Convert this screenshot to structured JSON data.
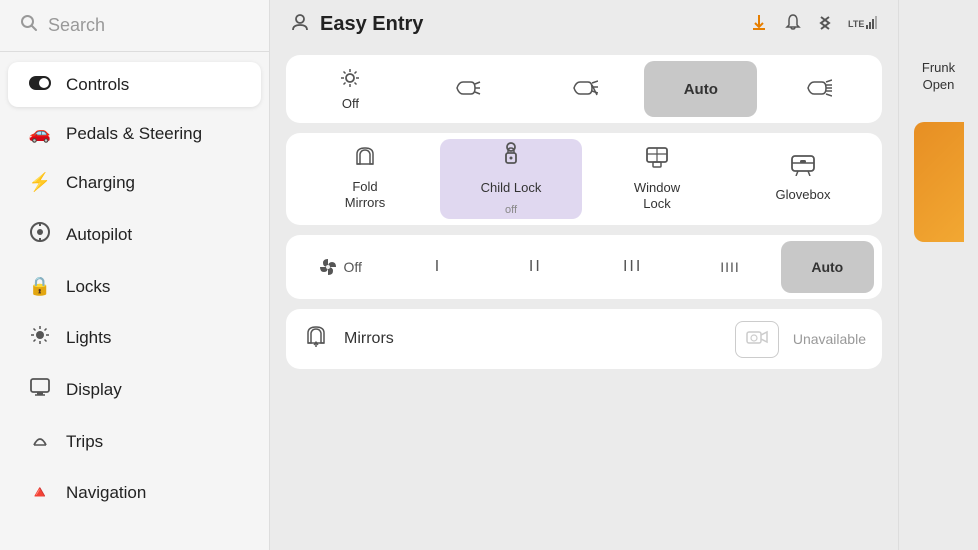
{
  "sidebar": {
    "search_placeholder": "Search",
    "items": [
      {
        "id": "controls",
        "label": "Controls",
        "icon": "toggle",
        "active": true
      },
      {
        "id": "pedals",
        "label": "Pedals & Steering",
        "icon": "car",
        "active": false
      },
      {
        "id": "charging",
        "label": "Charging",
        "icon": "bolt",
        "active": false
      },
      {
        "id": "autopilot",
        "label": "Autopilot",
        "icon": "steering",
        "active": false
      },
      {
        "id": "locks",
        "label": "Locks",
        "icon": "lock",
        "active": false
      },
      {
        "id": "lights",
        "label": "Lights",
        "icon": "sun",
        "active": false
      },
      {
        "id": "display",
        "label": "Display",
        "icon": "display",
        "active": false
      },
      {
        "id": "trips",
        "label": "Trips",
        "icon": "trips",
        "active": false
      },
      {
        "id": "navigation",
        "label": "Navigation",
        "icon": "nav",
        "active": false
      }
    ]
  },
  "header": {
    "title": "Easy Entry",
    "icons": {
      "download": "⬇",
      "bell": "🔔",
      "bluetooth": "🔵",
      "lte": "LTE"
    }
  },
  "light_controls": {
    "buttons": [
      {
        "id": "off",
        "label": "Off",
        "icon": "sun-off",
        "active": false
      },
      {
        "id": "parking",
        "label": "",
        "icon": "parking-lights",
        "active": false
      },
      {
        "id": "low",
        "label": "",
        "icon": "low-beam",
        "active": false
      },
      {
        "id": "auto",
        "label": "Auto",
        "icon": "",
        "active": true
      },
      {
        "id": "high",
        "label": "",
        "icon": "high-beam",
        "active": false
      }
    ]
  },
  "door_controls": {
    "buttons": [
      {
        "id": "fold-mirrors",
        "label": "Fold\nMirrors",
        "icon": "mirror",
        "sub_label": "",
        "active": false
      },
      {
        "id": "child-lock",
        "label": "Child Lock",
        "sub_label": "off",
        "icon": "child-lock",
        "active": true
      },
      {
        "id": "window-lock",
        "label": "Window\nLock",
        "icon": "window-lock",
        "active": false
      },
      {
        "id": "glovebox",
        "label": "Glovebox",
        "icon": "glovebox",
        "active": false
      }
    ]
  },
  "fan_controls": {
    "buttons": [
      {
        "id": "fan-off",
        "label": "Off",
        "icon": "fan",
        "active": false
      },
      {
        "id": "fan-1",
        "label": "I",
        "active": false
      },
      {
        "id": "fan-2",
        "label": "II",
        "active": false
      },
      {
        "id": "fan-3",
        "label": "III",
        "active": false
      },
      {
        "id": "fan-4",
        "label": "IIII",
        "active": false
      },
      {
        "id": "fan-auto",
        "label": "Auto",
        "active": true
      }
    ]
  },
  "mirrors_row": {
    "label": "Mirrors",
    "unavailable": "Unavailable"
  },
  "side_panel": {
    "frunk_label": "Frunk",
    "open_label": "Open"
  }
}
